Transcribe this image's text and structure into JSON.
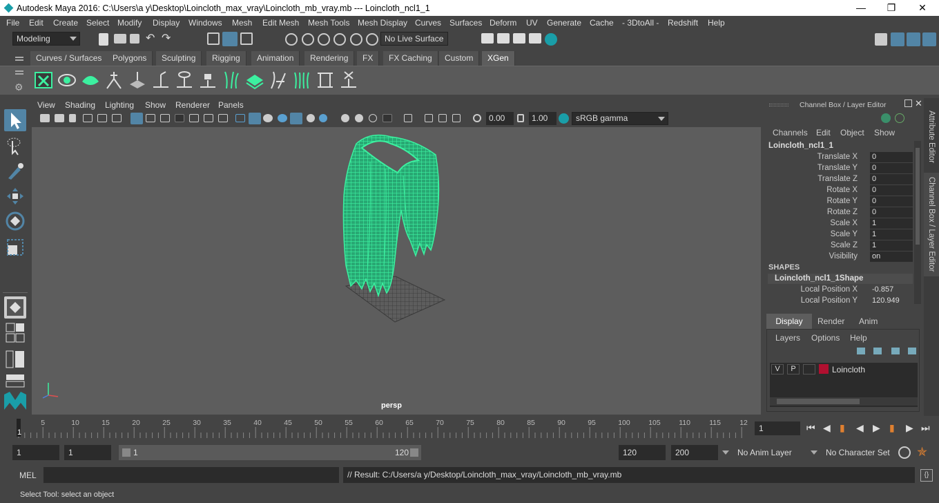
{
  "window": {
    "title": "Autodesk Maya 2016: C:\\Users\\a y\\Desktop\\Loincloth_max_vray\\Loincloth_mb_vray.mb   ---   Loincloth_ncl1_1",
    "minimize": "—",
    "maximize": "❐",
    "close": "✕"
  },
  "menubar": [
    "File",
    "Edit",
    "Create",
    "Select",
    "Modify",
    "Display",
    "Windows",
    "Mesh",
    "Edit Mesh",
    "Mesh Tools",
    "Mesh Display",
    "Curves",
    "Surfaces",
    "Deform",
    "UV",
    "Generate",
    "Cache",
    "- 3DtoAll -",
    "Redshift",
    "Help"
  ],
  "statusline": {
    "mode": "Modeling",
    "live_surface": "No Live Surface"
  },
  "shelf_tabs": [
    "Curves / Surfaces",
    "Polygons",
    "Sculpting",
    "Rigging",
    "Animation",
    "Rendering",
    "FX",
    "FX Caching",
    "Custom",
    "XGen"
  ],
  "shelf_active_tab": "XGen",
  "panel_menu": [
    "View",
    "Shading",
    "Lighting",
    "Show",
    "Renderer",
    "Panels"
  ],
  "panel_toolbar": {
    "exposure": "0.00",
    "gamma": "1.00",
    "color_space": "sRGB gamma"
  },
  "viewport": {
    "camera_label": "persp"
  },
  "channel_box": {
    "header": "Channel Box / Layer Editor",
    "menu": [
      "Channels",
      "Edit",
      "Object",
      "Show"
    ],
    "object_name": "Loincloth_ncl1_1",
    "channels": [
      {
        "label": "Translate X",
        "value": "0"
      },
      {
        "label": "Translate Y",
        "value": "0"
      },
      {
        "label": "Translate Z",
        "value": "0"
      },
      {
        "label": "Rotate X",
        "value": "0"
      },
      {
        "label": "Rotate Y",
        "value": "0"
      },
      {
        "label": "Rotate Z",
        "value": "0"
      },
      {
        "label": "Scale X",
        "value": "1"
      },
      {
        "label": "Scale Y",
        "value": "1"
      },
      {
        "label": "Scale Z",
        "value": "1"
      },
      {
        "label": "Visibility",
        "value": "on"
      }
    ],
    "shapes_header": "SHAPES",
    "shape_name": "Loincloth_ncl1_1Shape",
    "shape_channels": [
      {
        "label": "Local Position X",
        "value": "-0.857"
      },
      {
        "label": "Local Position Y",
        "value": "120.949"
      }
    ]
  },
  "layer_editor": {
    "tabs": [
      "Display",
      "Render",
      "Anim"
    ],
    "menu": [
      "Layers",
      "Options",
      "Help"
    ],
    "layer": {
      "v": "V",
      "p": "P",
      "name": "Loincloth",
      "color": "#b01030"
    }
  },
  "side_tabs": [
    "Attribute Editor",
    "Channel Box / Layer Editor"
  ],
  "timeslider": {
    "ticks": [
      "5",
      "10",
      "15",
      "20",
      "25",
      "30",
      "35",
      "40",
      "45",
      "50",
      "55",
      "60",
      "65",
      "70",
      "75",
      "80",
      "85",
      "90",
      "95",
      "100",
      "105",
      "110",
      "115",
      "12"
    ],
    "current_frame_marker": "1",
    "current_frame": "1"
  },
  "range": {
    "start": "1",
    "playback_start": "1",
    "slider_start": "1",
    "slider_end": "120",
    "playback_end": "120",
    "end": "200",
    "anim_layer": "No Anim Layer",
    "character_set": "No Character Set"
  },
  "command_line": {
    "label": "MEL",
    "result": "// Result: C:/Users/a y/Desktop/Loincloth_max_vray/Loincloth_mb_vray.mb"
  },
  "help_line": "Select Tool: select an object",
  "colors": {
    "mesh_wire": "#3cf0a0",
    "accent": "#5285a6",
    "xgen_active": "#5d5d5d"
  }
}
